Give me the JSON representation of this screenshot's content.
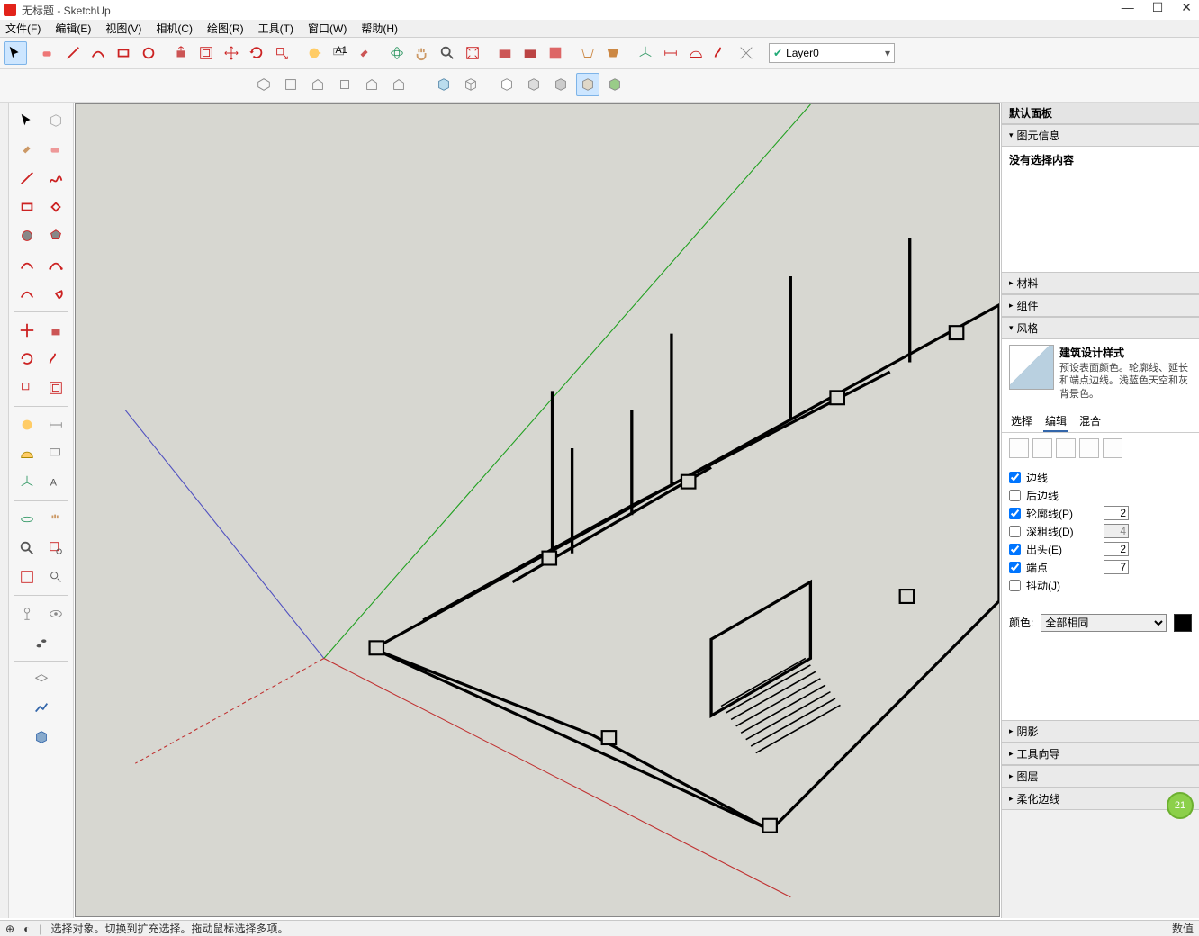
{
  "title": "无标题 - SketchUp",
  "menu": [
    "文件(F)",
    "编辑(E)",
    "视图(V)",
    "相机(C)",
    "绘图(R)",
    "工具(T)",
    "窗口(W)",
    "帮助(H)"
  ],
  "layer": {
    "name": "Layer0"
  },
  "panel": {
    "default_panel": "默认面板",
    "entity_info": "图元信息",
    "no_selection": "没有选择内容",
    "materials": "材料",
    "components": "组件",
    "styles": "风格",
    "style_name": "建筑设计样式",
    "style_desc": "预设表面颜色。轮廓线、延长和端点边线。浅蓝色天空和灰背景色。",
    "tab_select": "选择",
    "tab_edit": "编辑",
    "tab_mix": "混合",
    "edges": "边线",
    "back_edges": "后边线",
    "profiles": "轮廓线(P)",
    "profiles_val": "2",
    "depth_cue": "深粗线(D)",
    "depth_val": "4",
    "extension": "出头(E)",
    "extension_val": "2",
    "endpoints": "端点",
    "endpoints_val": "7",
    "jitter": "抖动(J)",
    "color_label": "颜色:",
    "color_mode": "全部相同",
    "shadows": "阴影",
    "instructor": "工具向导",
    "layers": "图层",
    "soften": "柔化边线"
  },
  "status": {
    "hint": "选择对象。切换到扩充选择。拖动鼠标选择多项。",
    "measure_label": "数值"
  },
  "badge": "21"
}
